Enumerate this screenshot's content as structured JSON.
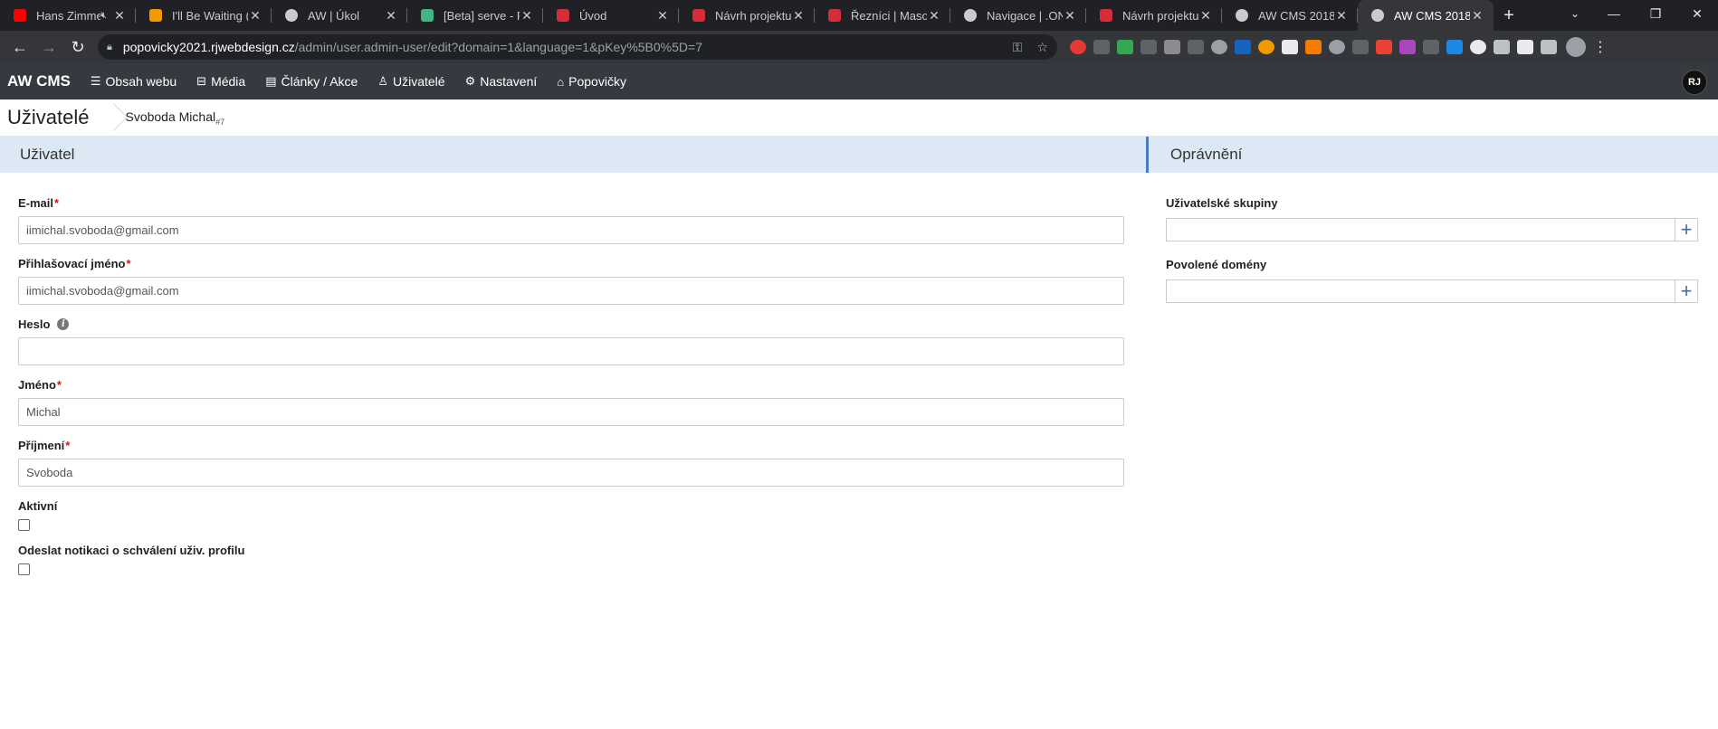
{
  "browser": {
    "tabs": [
      {
        "title": "Hans Zimmer",
        "icon": "youtube-icon",
        "color": "#ff0000",
        "muted": true
      },
      {
        "title": "I'll Be Waiting (C",
        "icon": "chart-icon",
        "color": "#f29900"
      },
      {
        "title": "AW | Úkol",
        "icon": "globe-icon",
        "color": "#c9cbcf"
      },
      {
        "title": "[Beta] serve - Pr",
        "icon": "vue-icon",
        "color": "#41b883"
      },
      {
        "title": "Úvod",
        "icon": "site-icon",
        "color": "#d62d3a"
      },
      {
        "title": "Návrh projektu",
        "icon": "site-icon",
        "color": "#d62d3a"
      },
      {
        "title": "Řezníci | Maso-p",
        "icon": "site-icon",
        "color": "#d62d3a"
      },
      {
        "title": "Navigace | .ONE",
        "icon": "globe-icon",
        "color": "#c9cbcf"
      },
      {
        "title": "Návrh projektu",
        "icon": "site-icon",
        "color": "#d62d3a"
      },
      {
        "title": "AW CMS 2018",
        "icon": "globe-icon",
        "color": "#c9cbcf"
      },
      {
        "title": "AW CMS 2018",
        "icon": "globe-icon",
        "color": "#c9cbcf",
        "active": true
      }
    ],
    "url_host": "popovicky2021.rjwebdesign.cz",
    "url_path": "/admin/user.admin-user/edit?domain=1&language=1&pKey%5B0%5D=7"
  },
  "app": {
    "brand": "AW CMS",
    "menu": [
      {
        "label": "Obsah webu",
        "icon": "bars-icon",
        "glyph": "☰"
      },
      {
        "label": "Média",
        "icon": "media-icon",
        "glyph": "⊟"
      },
      {
        "label": "Články / Akce",
        "icon": "newspaper-icon",
        "glyph": "▤"
      },
      {
        "label": "Uživatelé",
        "icon": "user-icon",
        "glyph": "♙"
      },
      {
        "label": "Nastavení",
        "icon": "gear-icon",
        "glyph": "⚙"
      },
      {
        "label": "Popovičky",
        "icon": "bank-icon",
        "glyph": "⌂"
      }
    ],
    "avatar_initials": "RJ"
  },
  "breadcrumb": {
    "title": "Uživatelé",
    "item": "Svoboda Michal",
    "item_id": "#7"
  },
  "left_panel": {
    "heading": "Uživatel",
    "fields": {
      "email_label": "E-mail",
      "email_value": "iimichal.svoboda@gmail.com",
      "login_label": "Přihlašovací jméno",
      "login_value": "iimichal.svoboda@gmail.com",
      "password_label": "Heslo",
      "password_value": "",
      "firstname_label": "Jméno",
      "firstname_value": "Michal",
      "lastname_label": "Příjmení",
      "lastname_value": "Svoboda",
      "active_label": "Aktivní",
      "notify_label": "Odeslat notikaci o schválení uživ. profilu"
    },
    "required_mark": "*"
  },
  "right_panel": {
    "heading": "Oprávnění",
    "groups_label": "Uživatelské skupiny",
    "domains_label": "Povolené domény",
    "add_glyph": "+"
  }
}
